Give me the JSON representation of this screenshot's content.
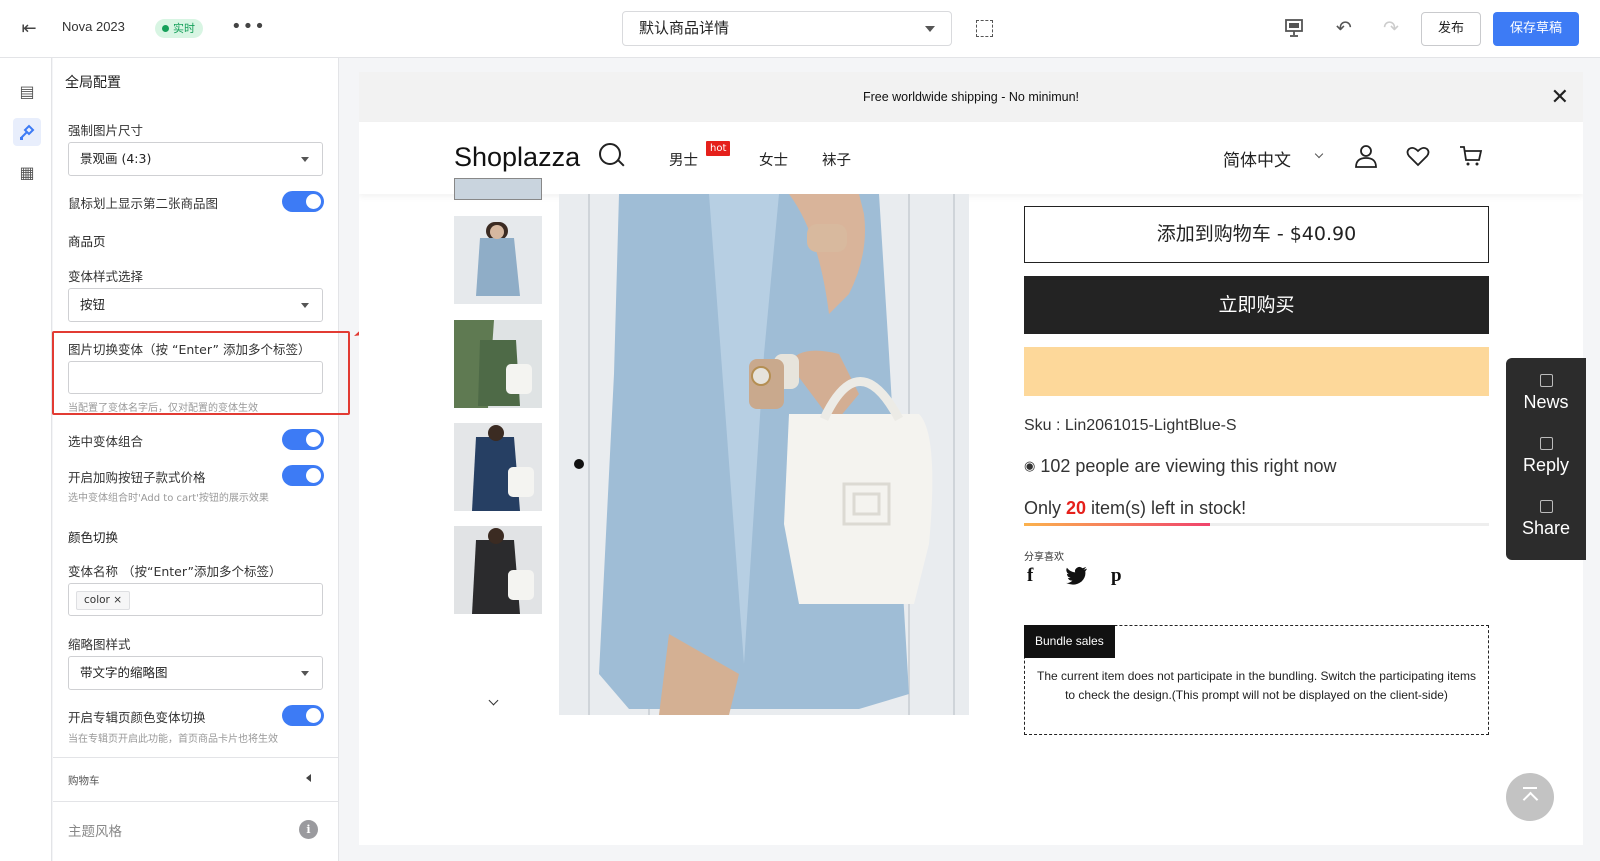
{
  "topbar": {
    "project_name": "Nova 2023",
    "status_badge": "实时",
    "more_label": "•••",
    "template_select": "默认商品详情",
    "publish_label": "发布",
    "save_draft_label": "保存草稿"
  },
  "panel": {
    "heading": "全局配置",
    "force_image_size_label": "强制图片尺寸",
    "force_image_size_value": "景观画 (4:3)",
    "hover_second_image_label": "鼠标划上显示第二张商品图",
    "product_page_section": "商品页",
    "variant_style_label": "变体样式选择",
    "variant_style_value": "按钮",
    "image_switch_label": "图片切换变体（按 “Enter” 添加多个标签）",
    "image_switch_placeholder": "",
    "image_switch_hint": "当配置了变体名字后，仅对配置的变体生效",
    "select_variant_combo_label": "选中变体组合",
    "cart_button_price_label": "开启加购按钮子款式价格",
    "cart_button_price_hint": "选中变体组合时'Add to cart'按钮的展示效果",
    "color_switch_section": "颜色切换",
    "variant_name_label": "变体名称 （按“Enter”添加多个标签）",
    "variant_name_tag": "color",
    "thumb_style_label": "缩略图样式",
    "thumb_style_value": "带文字的缩略图",
    "collection_color_switch_label": "开启专辑页颜色变体切换",
    "collection_color_switch_hint": "当在专辑页开启此功能，首页商品卡片也将生效",
    "cart_section": "购物车",
    "theme_style_section": "主题风格"
  },
  "toggles": {
    "hover_second_image": true,
    "select_variant_combo": true,
    "cart_button_price": true,
    "collection_color_switch": true
  },
  "store": {
    "announcement": "Free worldwide shipping - No minimun!",
    "logo": "Shoplazza",
    "nav": [
      "男士",
      "女士",
      "袜子"
    ],
    "hot_badge": "hot",
    "language": "简体中文",
    "add_to_cart": "添加到购物车 - $40.90",
    "buy_now": "立即购买",
    "sku": "Sku : Lin2061015-LightBlue-S",
    "viewing": "102 people are viewing this right now",
    "stock_prefix": "Only ",
    "stock_count": "20",
    "stock_suffix": " item(s) left in stock!",
    "stock_fill_percent": 40,
    "share_label": "分享喜欢",
    "social": [
      "f",
      "t",
      "p"
    ],
    "bundle_tag": "Bundle sales",
    "bundle_text": "The current item does not participate in the bundling. Switch the participating items to check the design.(This prompt will not be displayed on the client-side)"
  },
  "float_panel": {
    "items": [
      "News",
      "Reply",
      "Share"
    ]
  },
  "colors": {
    "accent": "#3d7bf5",
    "highlight_box": "#e23b33",
    "hot_badge": "#e5201b",
    "paypal": "#fdd89a"
  }
}
